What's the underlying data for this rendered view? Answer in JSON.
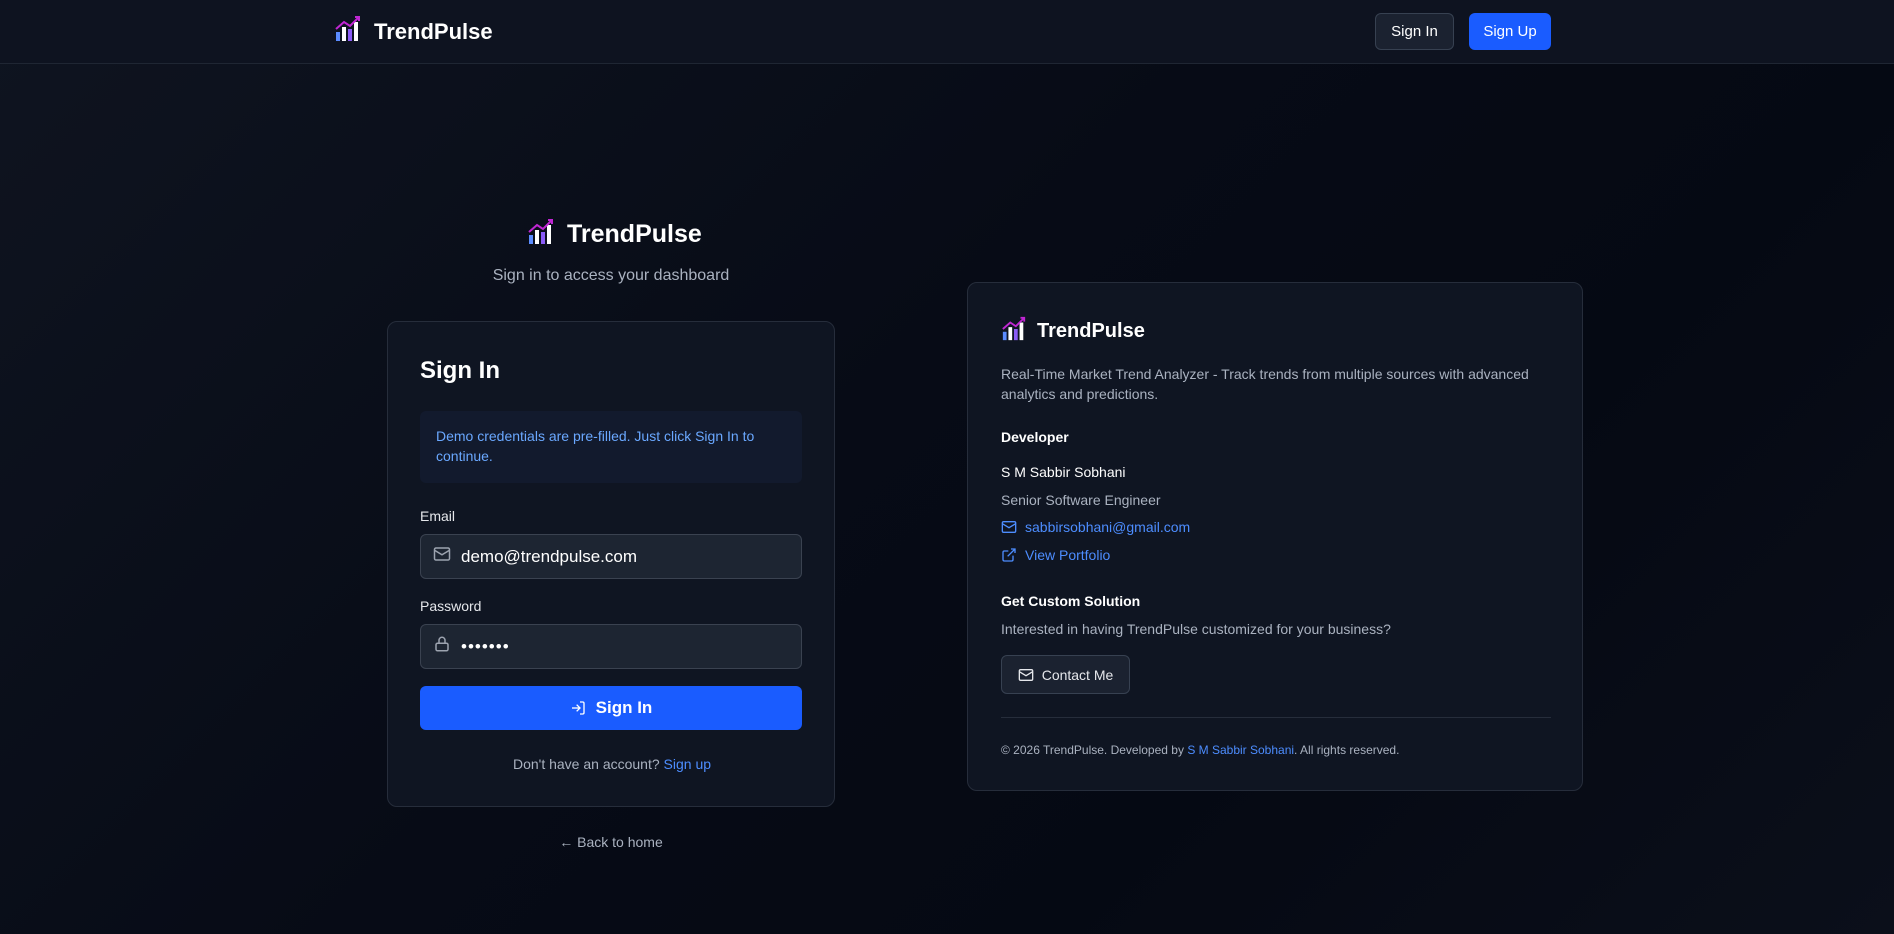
{
  "nav": {
    "brand_name": "TrendPulse",
    "signin_label": "Sign In",
    "signup_label": "Sign Up"
  },
  "auth": {
    "brand_name": "TrendPulse",
    "subtitle": "Sign in to access your dashboard",
    "card_title": "Sign In",
    "demo_note": "Demo credentials are pre-filled. Just click Sign In to continue.",
    "email_label": "Email",
    "email_value": "demo@trendpulse.com",
    "password_label": "Password",
    "password_value": "•••••••",
    "submit_label": "Sign In",
    "no_account_text": "Don't have an account?",
    "signup_link": "Sign up",
    "back_home": "← Back to home"
  },
  "info": {
    "brand_name": "TrendPulse",
    "description": "Real-Time Market Trend Analyzer - Track trends from multiple sources with advanced analytics and predictions.",
    "developer_heading": "Developer",
    "developer_name": "S M Sabbir Sobhani",
    "developer_role": "Senior Software Engineer",
    "email": "sabbirsobhani@gmail.com",
    "portfolio_label": "View Portfolio",
    "cta_heading": "Get Custom Solution",
    "cta_text": "Interested in having TrendPulse customized for your business?",
    "contact_label": "Contact Me",
    "footer_prefix": "© 2026 TrendPulse. Developed by",
    "footer_author": "S M Sabbir Sobhani",
    "footer_suffix": ". All rights reserved."
  },
  "icons": {
    "logo": "trend-bars-logo-icon",
    "mail": "mail-icon",
    "lock": "lock-icon",
    "signin": "log-in-icon",
    "external": "external-link-icon"
  },
  "colors": {
    "accent": "#1a5cff",
    "link": "#4d8dff",
    "note_text": "#6aa8ff",
    "card_bg": "#0f1522",
    "page_bg": "#070b16"
  }
}
